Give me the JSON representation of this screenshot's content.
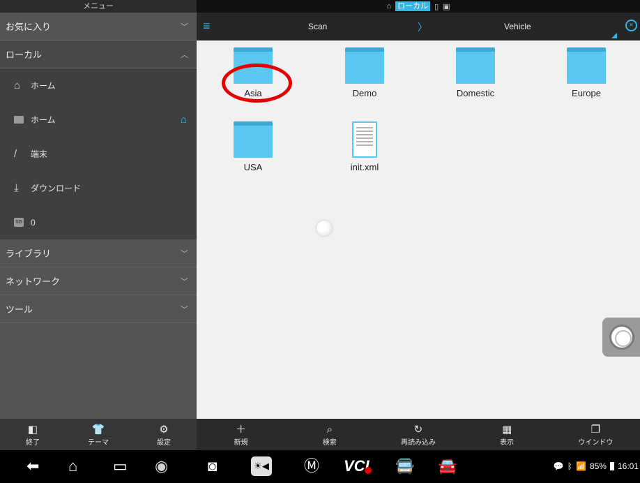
{
  "sidebar": {
    "title": "メニュー",
    "favorites": "お気に入り",
    "local": "ローカル",
    "items": [
      {
        "label": "ホーム",
        "icon": "home-outline-icon"
      },
      {
        "label": "ホーム",
        "icon": "folder-home-icon"
      },
      {
        "label": "端末",
        "icon": "slash-icon"
      },
      {
        "label": "ダウンロード",
        "icon": "download-icon"
      },
      {
        "label": "0",
        "icon": "sd-card-icon"
      }
    ],
    "library": "ライブラリ",
    "network": "ネットワーク",
    "tools": "ツール",
    "toolbar": {
      "exit": "終了",
      "theme": "テーマ",
      "settings": "設定"
    }
  },
  "topbar": {
    "status_local": "ローカル",
    "breadcrumb": [
      "Scan",
      "Vehicle"
    ]
  },
  "files": [
    {
      "name": "Asia",
      "type": "folder"
    },
    {
      "name": "Demo",
      "type": "folder"
    },
    {
      "name": "Domestic",
      "type": "folder"
    },
    {
      "name": "Europe",
      "type": "folder"
    },
    {
      "name": "USA",
      "type": "folder"
    },
    {
      "name": "init.xml",
      "type": "document"
    }
  ],
  "toolbar": {
    "new": "新規",
    "search": "検索",
    "reload": "再読み込み",
    "view": "表示",
    "window": "ウインドウ"
  },
  "navbar": {
    "vci": "VCI",
    "battery": "85%",
    "time": "16:01"
  },
  "colors": {
    "accent": "#33b5e5",
    "folder": "#5ac8f0",
    "highlight_circle": "#e30000"
  }
}
